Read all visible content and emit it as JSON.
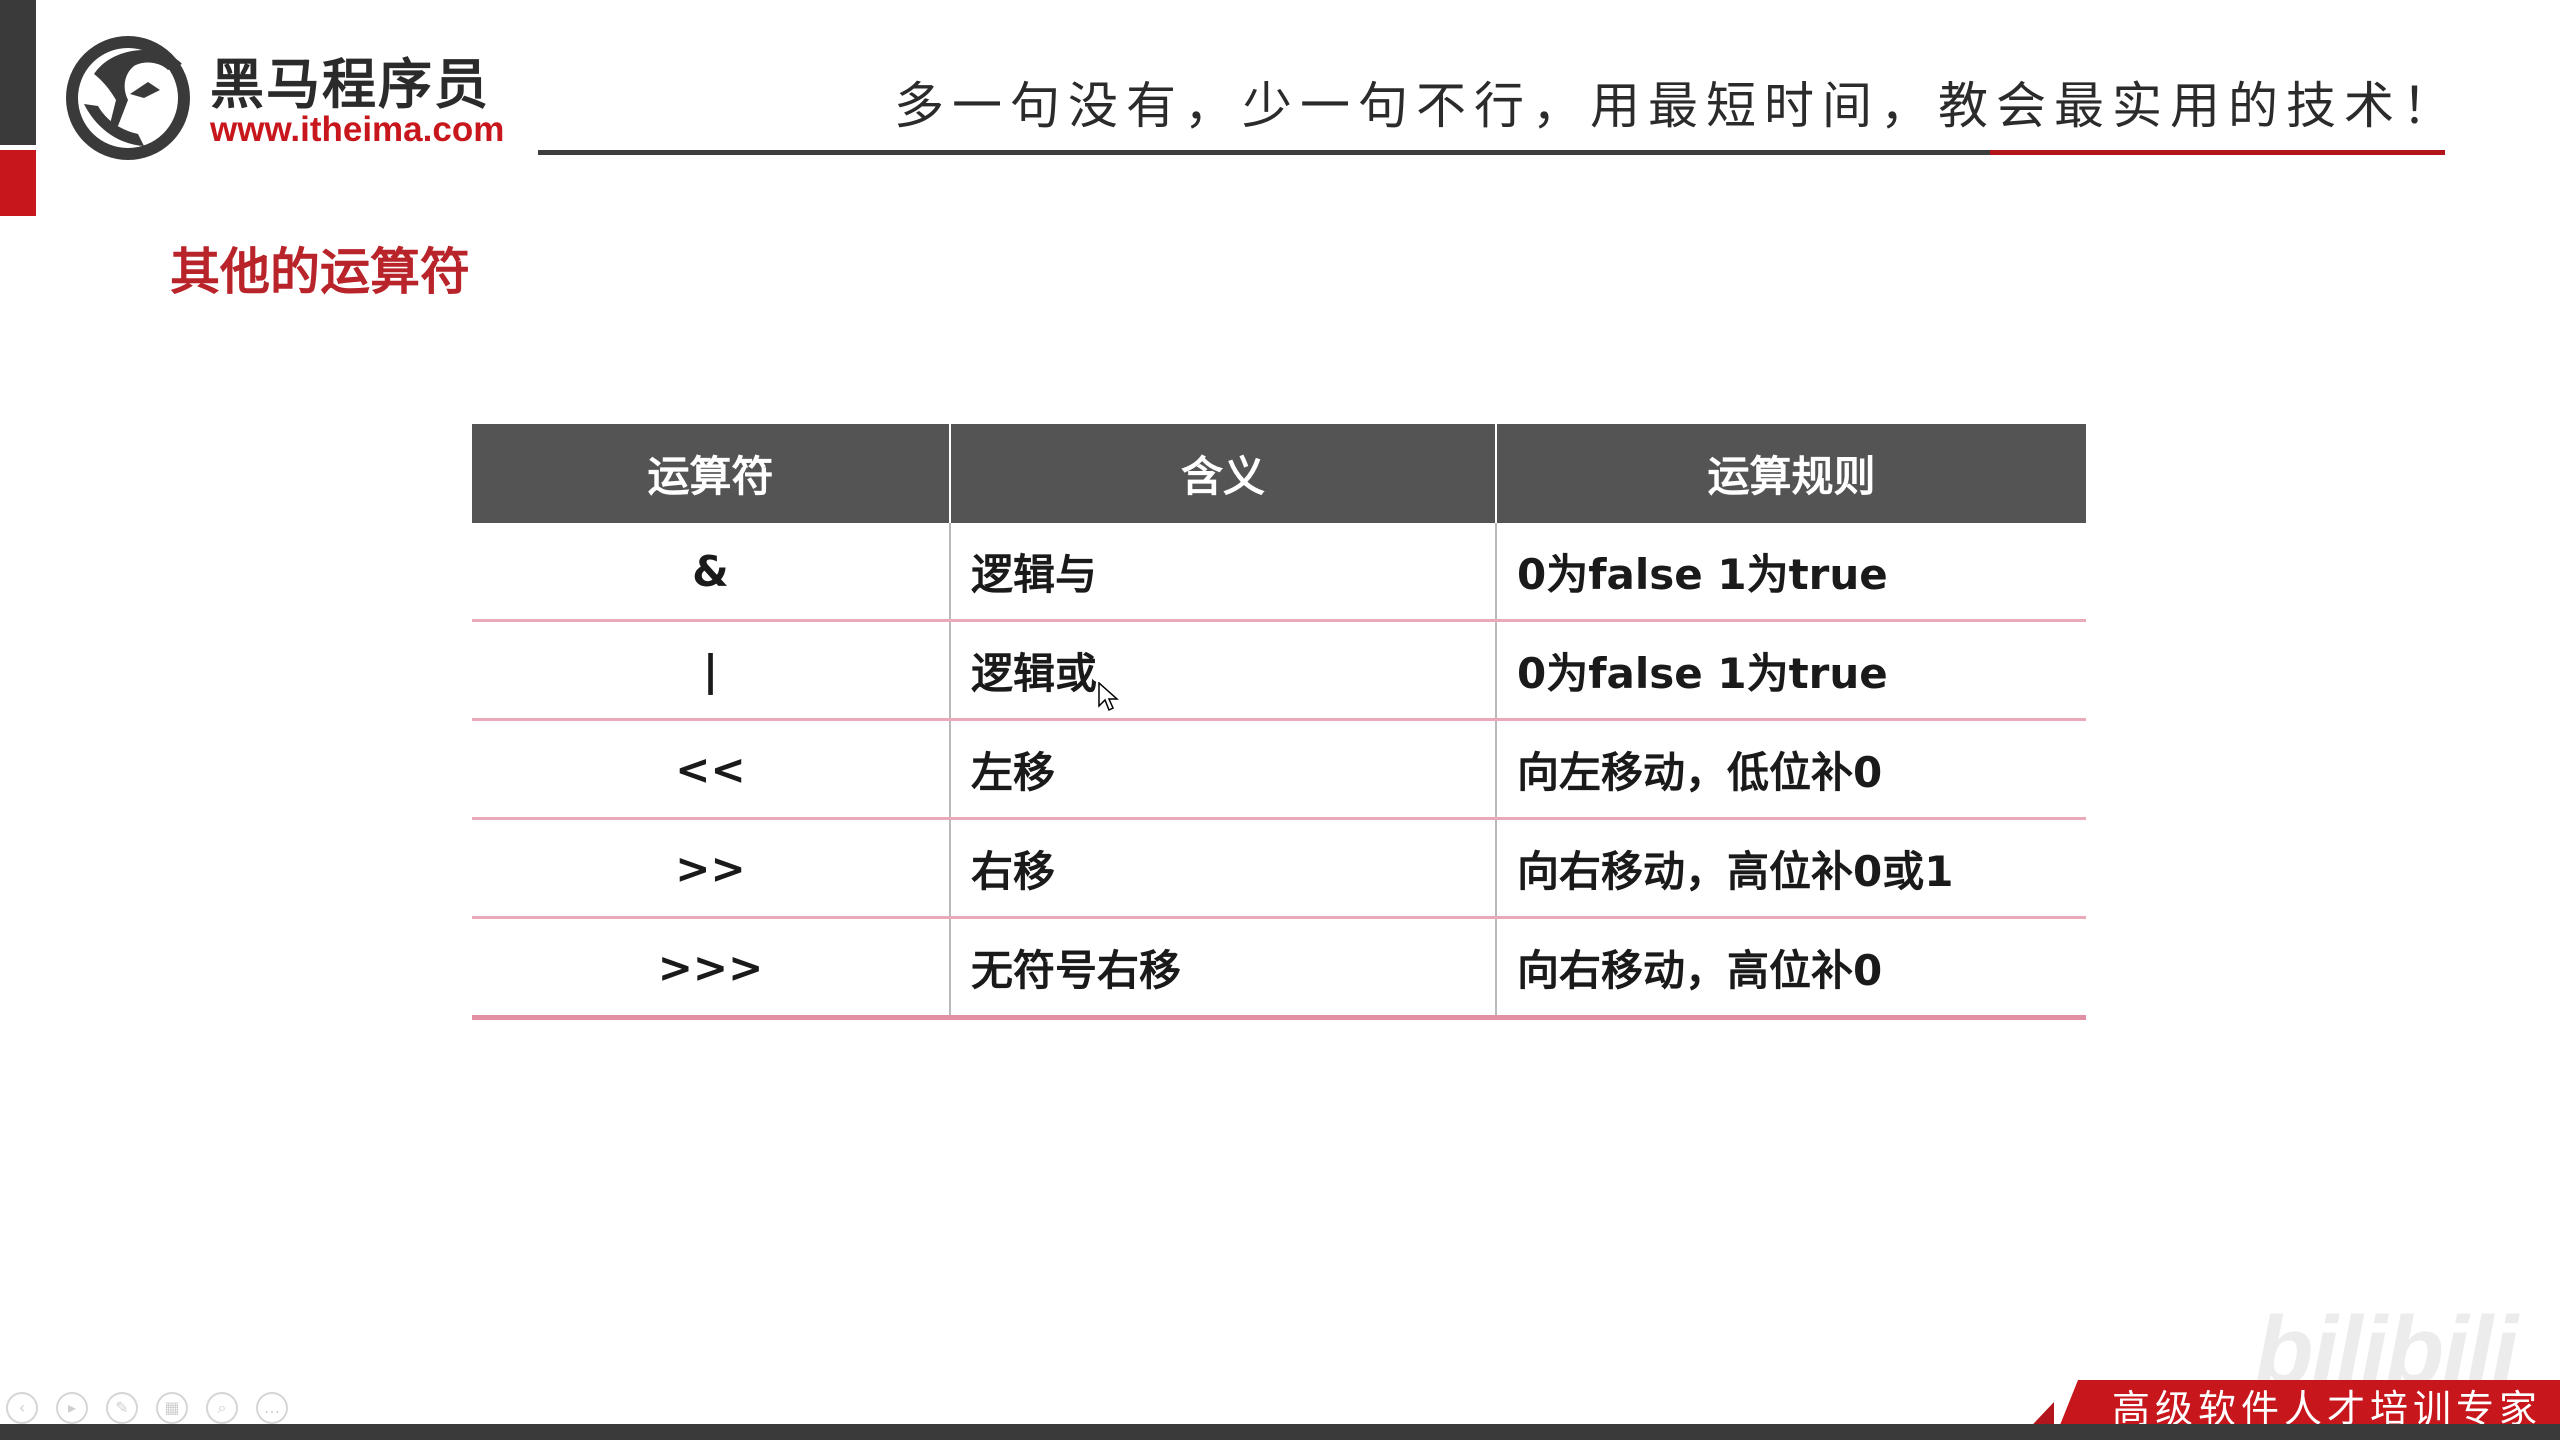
{
  "header": {
    "logo_cn": "黑马程序员",
    "logo_url": "www.itheima.com",
    "slogan": "多一句没有，少一句不行，用最短时间，教会最实用的技术！"
  },
  "section_title": "其他的运算符",
  "table": {
    "headers": [
      "运算符",
      "含义",
      "运算规则"
    ],
    "rows": [
      {
        "op": "&",
        "meaning": "逻辑与",
        "rule": "0为false 1为true"
      },
      {
        "op": "|",
        "meaning": "逻辑或",
        "rule": "0为false 1为true"
      },
      {
        "op": "<<",
        "meaning": "左移",
        "rule": "向左移动，低位补0"
      },
      {
        "op": ">>",
        "meaning": "右移",
        "rule": "向右移动，高位补0或1"
      },
      {
        "op": ">>>",
        "meaning": "无符号右移",
        "rule": "向右移动，高位补0"
      }
    ]
  },
  "footer": {
    "banner_text": "高级软件人才培训专家",
    "watermark": "bilibili"
  },
  "colors": {
    "brand_red": "#c8161d",
    "header_gray": "#545454",
    "row_divider_pink": "#e9a9b8"
  },
  "icons": [
    "logo-horse-icon",
    "mouse-cursor-icon",
    "player-control-icons"
  ]
}
